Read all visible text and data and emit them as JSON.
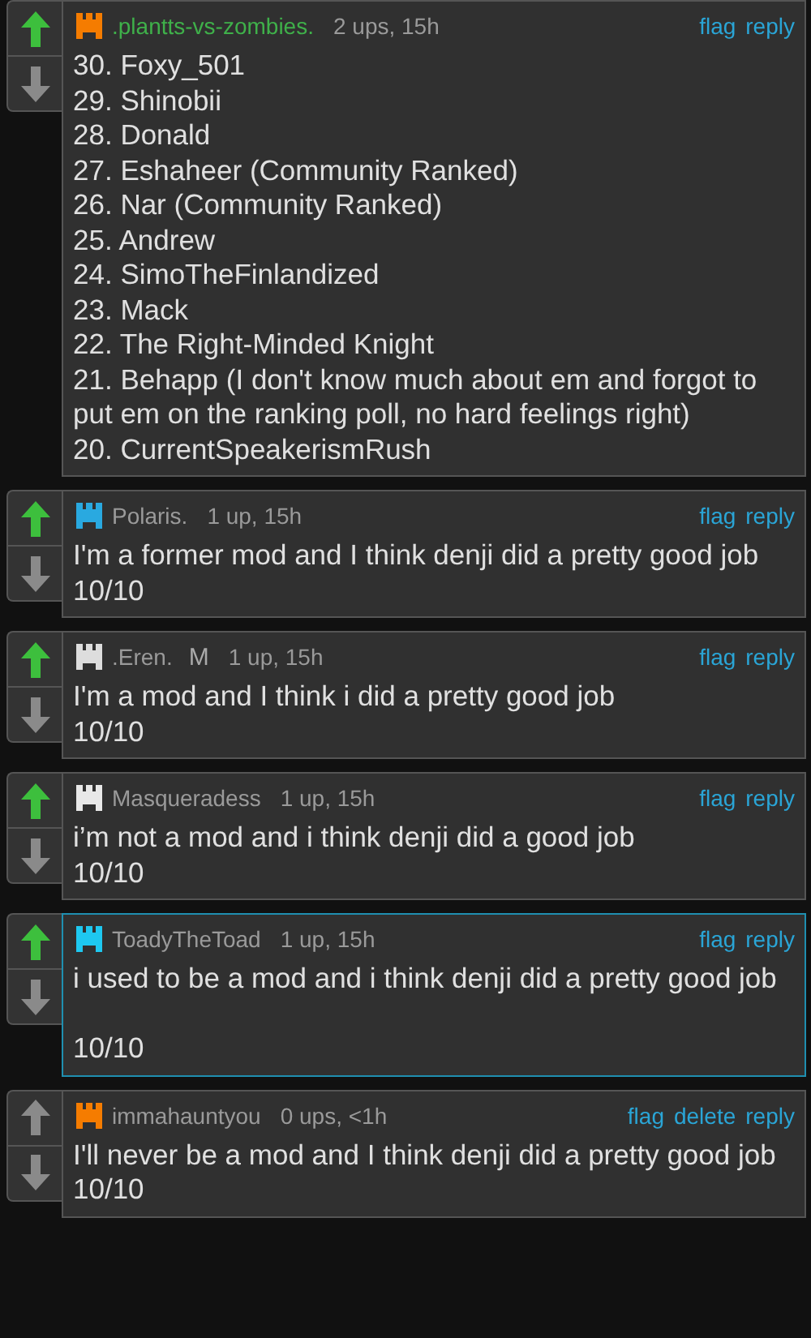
{
  "comments": [
    {
      "upvoted": true,
      "color": "#f57c00",
      "username": ".plantts-vs-zombies.",
      "op": true,
      "meta": "2 ups, 15h",
      "actions": [
        "flag",
        "reply"
      ],
      "highlighted": false,
      "body": "30. Foxy_501\n29. Shinobii\n28. Donald\n27. Eshaheer (Community Ranked)\n26. Nar (Community Ranked)\n25. Andrew\n24. SimoTheFinlandized\n23. Mack\n22. The Right-Minded Knight\n21. Behapp (I don't know much about em and forgot to put em on the ranking poll, no hard feelings right)\n20. CurrentSpeakerismRush"
    },
    {
      "upvoted": true,
      "color": "#29a9e0",
      "username": "Polaris.",
      "op": false,
      "meta": "1 up, 15h",
      "actions": [
        "flag",
        "reply"
      ],
      "highlighted": false,
      "body": "I'm a former mod and I think denji did a pretty good job\n10/10"
    },
    {
      "upvoted": true,
      "color": "#dddddd",
      "username": ".Eren.",
      "op": false,
      "mod_badge": "M",
      "meta": "1 up, 15h",
      "actions": [
        "flag",
        "reply"
      ],
      "highlighted": false,
      "body": "I'm a mod and I think i did a pretty good job\n10/10"
    },
    {
      "upvoted": true,
      "color": "#e8e8e8",
      "username": "Masqueradess",
      "op": false,
      "meta": "1 up, 15h",
      "actions": [
        "flag",
        "reply"
      ],
      "highlighted": false,
      "body": "i’m not a mod and i think denji did a good job\n10/10"
    },
    {
      "upvoted": true,
      "color": "#1ec8f0",
      "username": "ToadyTheToad",
      "op": false,
      "meta": "1 up, 15h",
      "actions": [
        "flag",
        "reply"
      ],
      "highlighted": true,
      "body": "i used to be a mod and i think denji did a pretty good job\n\n10/10"
    },
    {
      "upvoted": false,
      "color": "#f57c00",
      "username": "immahauntyou",
      "op": false,
      "meta": "0 ups, <1h",
      "actions": [
        "flag",
        "delete",
        "reply"
      ],
      "highlighted": false,
      "body": "I'll never be a mod and I think denji did a pretty good job\n10/10"
    }
  ]
}
